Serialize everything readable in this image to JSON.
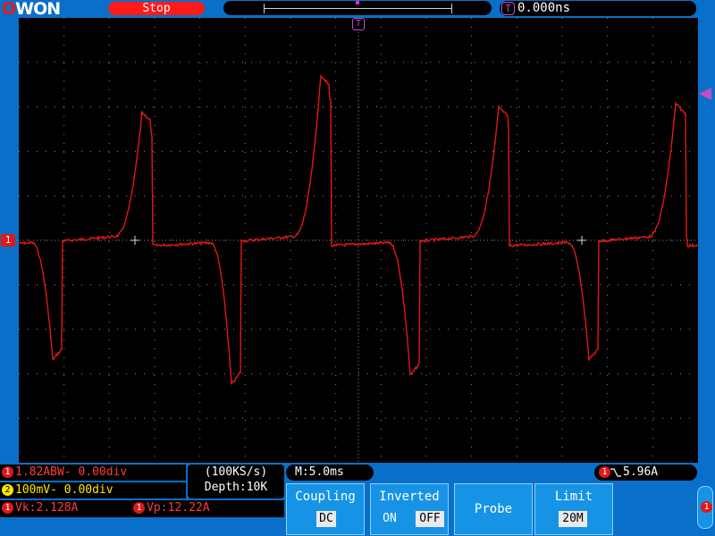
{
  "brand": {
    "logo_o": "O",
    "logo_rest": "WON"
  },
  "status": "Stop",
  "trigger_time": {
    "icon": "T",
    "value": "0.000ns"
  },
  "ch1_marker": "1",
  "trigger_marker": "T",
  "channels": {
    "ch1": {
      "num": "1",
      "scale": "1.82ABW-",
      "offset": "0.00div"
    },
    "ch2": {
      "num": "2",
      "scale": "100mV-",
      "offset": "0.00div"
    }
  },
  "sampling": {
    "rate": "(100KS/s)",
    "depth": "Depth:10K"
  },
  "timebase": "M:5.0ms",
  "trigger_readout": {
    "num": "1",
    "value": "5.96A"
  },
  "measurements": [
    {
      "num": "1",
      "text": "Vk:2.128A"
    },
    {
      "num": "1",
      "text": "Vp:12.22A"
    }
  ],
  "menu": {
    "coupling": {
      "label": "Coupling",
      "value": "DC"
    },
    "inverted": {
      "label": "Inverted",
      "on": "ON",
      "off": "OFF"
    },
    "probe": {
      "label": "Probe"
    },
    "limit": {
      "label": "Limit",
      "value": "20M"
    }
  },
  "side_indicator": "1",
  "colors": {
    "ch1": "#e01818",
    "ch2": "#ffe600",
    "trigger": "#c44cc4",
    "grid": "#8a8a8a",
    "background": "#0a6fc8"
  },
  "waveform": {
    "ch1_state": "running-stopped",
    "note_vertical_divs": 10,
    "note_horizontal_divs": 15
  }
}
